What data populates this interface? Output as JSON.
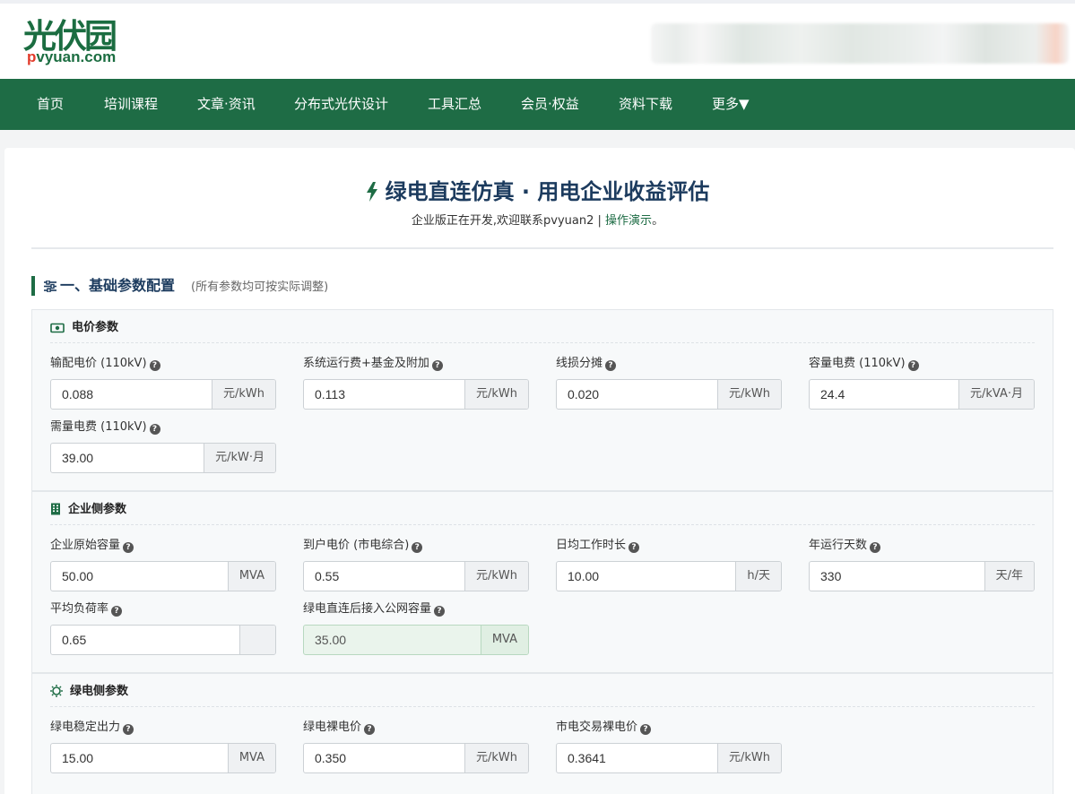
{
  "site": {
    "logo_main": "光伏园",
    "logo_sub_p": "p",
    "logo_sub_rest": "vyuan.com"
  },
  "nav": [
    {
      "label": "首页"
    },
    {
      "label": "培训课程"
    },
    {
      "label": "文章·资讯"
    },
    {
      "label": "分布式光伏设计"
    },
    {
      "label": "工具汇总"
    },
    {
      "label": "会员·权益"
    },
    {
      "label": "资料下载"
    },
    {
      "label": "更多▼"
    }
  ],
  "page": {
    "title": "绿电直连仿真 · 用电企业收益评估",
    "subtitle_prefix": "企业版正在开发,欢迎联系pvyuan2 | ",
    "subtitle_link": "操作演示",
    "subtitle_suffix": "。"
  },
  "section": {
    "title": "一、基础参数配置",
    "note": "(所有参数均可按实际调整)"
  },
  "groups": {
    "price": {
      "title": "电价参数",
      "fields": [
        {
          "label": "输配电价 (110kV)",
          "value": "0.088",
          "unit": "元/kWh"
        },
        {
          "label": "系统运行费+基金及附加",
          "value": "0.113",
          "unit": "元/kWh"
        },
        {
          "label": "线损分摊",
          "value": "0.020",
          "unit": "元/kWh"
        },
        {
          "label": "容量电费 (110kV)",
          "value": "24.4",
          "unit": "元/kVA·月"
        },
        {
          "label": "需量电费 (110kV)",
          "value": "39.00",
          "unit": "元/kW·月"
        }
      ]
    },
    "enterprise": {
      "title": "企业侧参数",
      "fields": [
        {
          "label": "企业原始容量",
          "value": "50.00",
          "unit": "MVA"
        },
        {
          "label": "到户电价 (市电综合)",
          "value": "0.55",
          "unit": "元/kWh"
        },
        {
          "label": "日均工作时长",
          "value": "10.00",
          "unit": "h/天"
        },
        {
          "label": "年运行天数",
          "value": "330",
          "unit": "天/年"
        },
        {
          "label": "平均负荷率",
          "value": "0.65",
          "unit": ""
        },
        {
          "label": "绿电直连后接入公网容量",
          "value": "35.00",
          "unit": "MVA"
        }
      ]
    },
    "green": {
      "title": "绿电侧参数",
      "fields": [
        {
          "label": "绿电稳定出力",
          "value": "15.00",
          "unit": "MVA"
        },
        {
          "label": "绿电裸电价",
          "value": "0.350",
          "unit": "元/kWh"
        },
        {
          "label": "市电交易裸电价",
          "value": "0.3641",
          "unit": "元/kWh"
        }
      ]
    }
  },
  "colors": {
    "brand_green": "#1e6c45",
    "title_navy": "#1c3b5e",
    "logo_red": "#e23b2a"
  },
  "icons": {
    "title": "bolt-icon",
    "section": "sliders-icon",
    "price": "money-bill-icon",
    "enterprise": "building-icon",
    "green": "sun-icon",
    "help": "question-circle-icon"
  }
}
